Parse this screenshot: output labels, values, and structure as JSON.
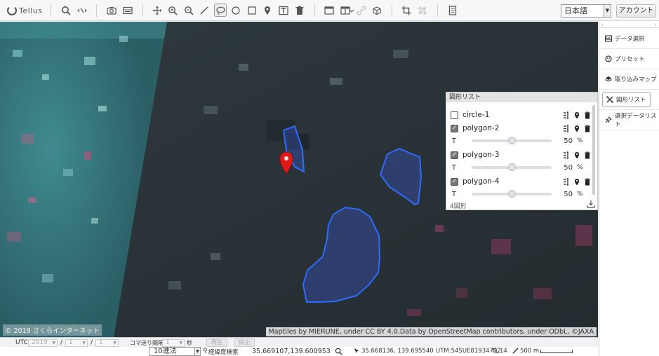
{
  "app": {
    "logo_text": "Tellus"
  },
  "toolbar": {
    "icons": [
      "search-icon",
      "sync-icon",
      "camera-icon",
      "layers-box-icon",
      "move-icon",
      "zoom-in-icon",
      "zoom-out-icon",
      "line-icon",
      "lasso-icon",
      "circle-icon",
      "rectangle-icon",
      "marker-icon",
      "text-icon",
      "trash-icon",
      "single-view-icon",
      "split-view-icon",
      "link-icon",
      "cube-icon",
      "crop-icon",
      "crop-disabled-icon",
      "panel-icon"
    ],
    "language": "日本語",
    "account_label": "アカウント"
  },
  "map": {
    "attribution": "Maptiles by MIERUNE, under CC BY 4.0.Data by OpenStreetMap contributors, under ODbL, ©JAXA",
    "copyright": "© 2019 さくらインターネット"
  },
  "shape_panel": {
    "title": "図形リスト",
    "shapes": [
      {
        "name": "circle-1",
        "checked": false
      },
      {
        "name": "polygon-2",
        "checked": true,
        "t_label": "T",
        "opacity": 50,
        "unit": "%"
      },
      {
        "name": "polygon-3",
        "checked": true,
        "t_label": "T",
        "opacity": 50,
        "unit": "%"
      },
      {
        "name": "polygon-4",
        "checked": true,
        "t_label": "T",
        "opacity": 50,
        "unit": "%"
      }
    ],
    "count_label": "4図形"
  },
  "sidebar": {
    "items": [
      {
        "label": "データ選択",
        "icon": "data-select-icon"
      },
      {
        "label": "プリセット",
        "icon": "preset-icon"
      },
      {
        "label": "取り込みマップ",
        "icon": "imported-map-icon"
      },
      {
        "label": "図形リスト",
        "icon": "shape-list-icon",
        "active": true
      },
      {
        "label": "選択データリスト",
        "icon": "pin-icon"
      }
    ]
  },
  "timebar": {
    "utc_label": "UTC",
    "year": "2019",
    "month": "1",
    "day": "1",
    "sep1": "/",
    "sep2": "/",
    "frame_interval_label": "コマ送り間隔",
    "interval_value": "1",
    "seconds_label": "秒",
    "play_label": "再生",
    "stop_label": "停止"
  },
  "statusbar": {
    "notation": "10進法",
    "coord_search_label": "経緯度検索",
    "coord_search_value": "35.669107,139.600953",
    "cursor_coord": "35.668136, 139.695540",
    "utm": "UTM:54SUE81934792",
    "zoom": "14",
    "scale": "500 m"
  },
  "colors": {
    "polygon_stroke": "#2f6bff",
    "polygon_fill": "#3a5ad8",
    "marker": "#e0191b"
  }
}
